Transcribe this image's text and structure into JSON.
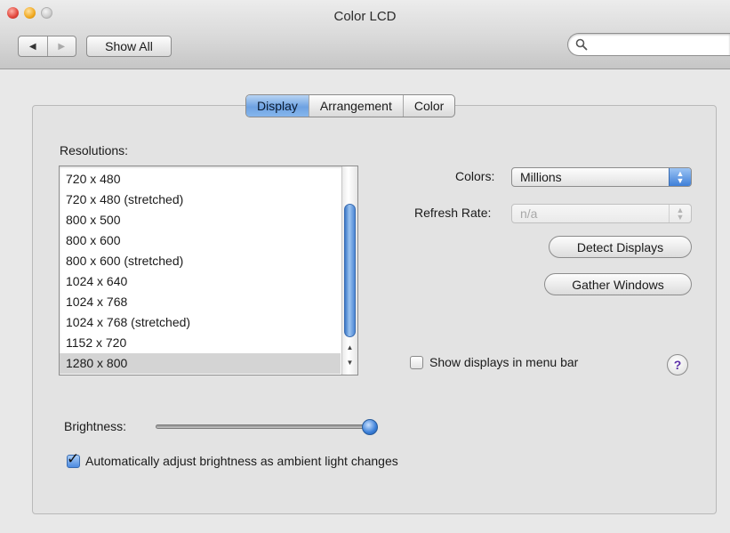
{
  "window": {
    "title": "Color LCD"
  },
  "toolbar": {
    "back_glyph": "◀",
    "forward_glyph": "▶",
    "show_all_label": "Show All",
    "search_placeholder": ""
  },
  "tabs": [
    {
      "label": "Display",
      "active": true
    },
    {
      "label": "Arrangement",
      "active": false
    },
    {
      "label": "Color",
      "active": false
    }
  ],
  "resolutions": {
    "label": "Resolutions:",
    "items": [
      "720 x 480",
      "720 x 480 (stretched)",
      "800 x 500",
      "800 x 600",
      "800 x 600 (stretched)",
      "1024 x 640",
      "1024 x 768",
      "1024 x 768 (stretched)",
      "1152 x 720",
      "1280 x 800"
    ],
    "selected": "1280 x 800"
  },
  "colors": {
    "label": "Colors:",
    "value": "Millions"
  },
  "refresh_rate": {
    "label": "Refresh Rate:",
    "value": "n/a",
    "enabled": false
  },
  "buttons": {
    "detect_displays": "Detect Displays",
    "gather_windows": "Gather Windows"
  },
  "show_in_menu_bar": {
    "label": "Show displays in menu bar",
    "checked": false
  },
  "help": {
    "glyph": "?"
  },
  "brightness": {
    "label": "Brightness:",
    "level": 1.0
  },
  "auto_brightness": {
    "label": "Automatically adjust brightness as ambient light changes",
    "checked": true
  },
  "colors_accent": {
    "selection_blue": "#6ea2e2",
    "window_bg": "#e8e8e8"
  }
}
